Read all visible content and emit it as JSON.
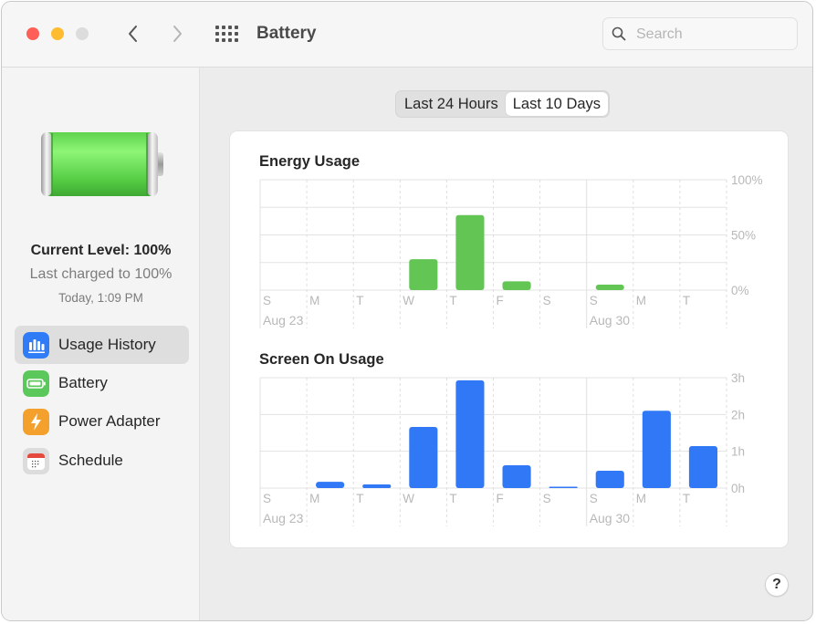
{
  "window": {
    "title": "Battery",
    "search_placeholder": "Search",
    "search_value": ""
  },
  "sidebar": {
    "current_level": "Current Level: 100%",
    "last_charged": "Last charged to 100%",
    "last_charged_time": "Today, 1:09 PM",
    "battery_level_fraction": 1.0,
    "items": [
      {
        "label": "Usage History",
        "icon": "bar-chart-icon",
        "color": "#2f7cf6",
        "active": true
      },
      {
        "label": "Battery",
        "icon": "battery-icon",
        "color": "#5ac85a",
        "active": false
      },
      {
        "label": "Power Adapter",
        "icon": "lightning-icon",
        "color": "#f4a02c",
        "active": false
      },
      {
        "label": "Schedule",
        "icon": "calendar-icon",
        "color": "#e9e9e9",
        "active": false
      }
    ]
  },
  "segmented": {
    "options": [
      "Last 24 Hours",
      "Last 10 Days"
    ],
    "selected": "Last 10 Days"
  },
  "help_label": "?",
  "chart_data": [
    {
      "type": "bar",
      "title": "Energy Usage",
      "categories": [
        "S",
        "M",
        "T",
        "W",
        "T",
        "F",
        "S",
        "S",
        "M",
        "T"
      ],
      "date_labels": [
        {
          "index": 0,
          "label": "Aug 23"
        },
        {
          "index": 7,
          "label": "Aug 30"
        }
      ],
      "values": [
        0,
        0,
        0,
        28,
        68,
        8,
        0,
        5,
        0,
        0
      ],
      "unit": "%",
      "ylim": [
        0,
        100
      ],
      "yticks": [
        {
          "value": 100,
          "label": "100%"
        },
        {
          "value": 50,
          "label": "50%"
        },
        {
          "value": 0,
          "label": "0%"
        }
      ],
      "gridlines": [
        0,
        25,
        50,
        75,
        100
      ],
      "color": "#62c554",
      "ylabel_position": "right"
    },
    {
      "type": "bar",
      "title": "Screen On Usage",
      "categories": [
        "S",
        "M",
        "T",
        "W",
        "T",
        "F",
        "S",
        "S",
        "M",
        "T"
      ],
      "date_labels": [
        {
          "index": 0,
          "label": "Aug 23"
        },
        {
          "index": 7,
          "label": "Aug 30"
        }
      ],
      "values": [
        0,
        0.17,
        0.1,
        1.66,
        2.93,
        0.62,
        0.03,
        0.47,
        2.1,
        1.14
      ],
      "unit": "h",
      "ylim": [
        0,
        3
      ],
      "yticks": [
        {
          "value": 3,
          "label": "3h"
        },
        {
          "value": 2,
          "label": "2h"
        },
        {
          "value": 1,
          "label": "1h"
        },
        {
          "value": 0,
          "label": "0h"
        }
      ],
      "gridlines": [
        0,
        1,
        2,
        3
      ],
      "color": "#3078f5",
      "ylabel_position": "right"
    }
  ]
}
